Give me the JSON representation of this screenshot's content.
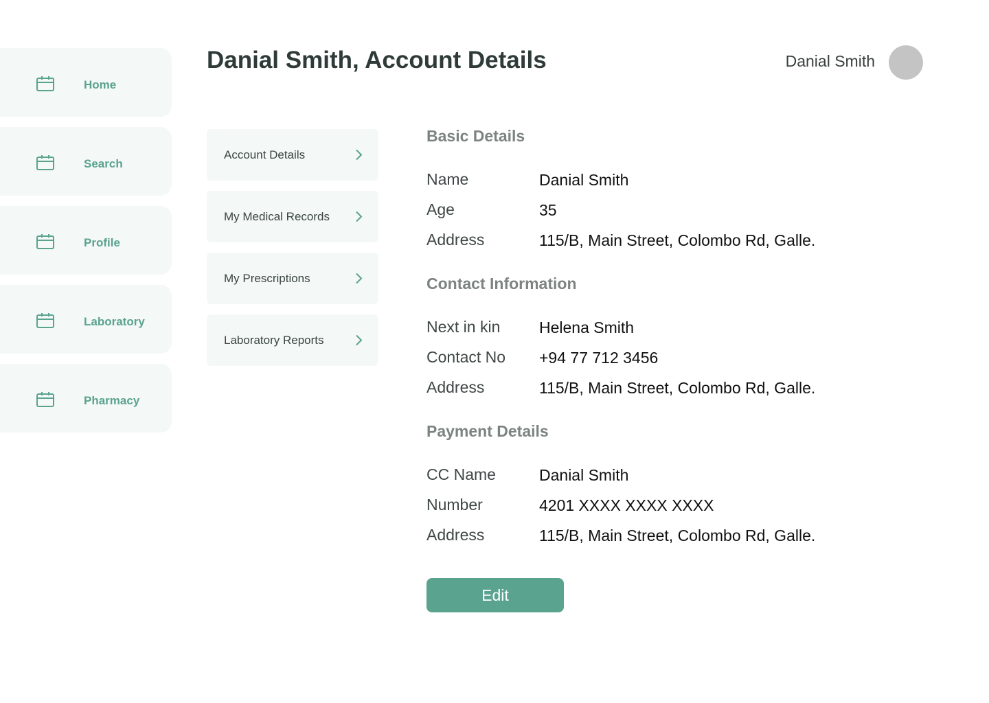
{
  "colors": {
    "accent": "#5aa38e",
    "nav_bg": "#f4f8f7",
    "avatar": "#c4c4c4",
    "title": "#2f3b38",
    "section_title": "#7c8482"
  },
  "sidebar": {
    "items": [
      {
        "label": "Home",
        "icon": "calendar-icon"
      },
      {
        "label": "Search",
        "icon": "calendar-icon"
      },
      {
        "label": "Profile",
        "icon": "calendar-icon"
      },
      {
        "label": "Laboratory",
        "icon": "calendar-icon"
      },
      {
        "label": "Pharmacy",
        "icon": "calendar-icon"
      }
    ]
  },
  "header": {
    "title_prefix": "Danial Smith,",
    "title_bold": "Account Details",
    "user_name": "Danial Smith"
  },
  "submenu": {
    "items": [
      {
        "label": "Account Details",
        "icon": "chevron-right-icon"
      },
      {
        "label": "My Medical Records",
        "icon": "chevron-right-icon"
      },
      {
        "label": "My Prescriptions",
        "icon": "chevron-right-icon"
      },
      {
        "label": "Laboratory Reports",
        "icon": "chevron-right-icon"
      }
    ]
  },
  "details": {
    "basic": {
      "title": "Basic Details",
      "rows": [
        {
          "label": "Name",
          "value": "Danial Smith"
        },
        {
          "label": "Age",
          "value": "35"
        },
        {
          "label": "Address",
          "value": "115/B, Main Street, Colombo Rd, Galle."
        }
      ]
    },
    "contact": {
      "title": "Contact Information",
      "rows": [
        {
          "label": "Next in kin",
          "value": "Helena Smith"
        },
        {
          "label": "Contact No",
          "value": "+94 77 712 3456"
        },
        {
          "label": "Address",
          "value": "115/B, Main Street, Colombo Rd, Galle."
        }
      ]
    },
    "payment": {
      "title": "Payment Details",
      "rows": [
        {
          "label": "CC Name",
          "value": "Danial Smith"
        },
        {
          "label": "Number",
          "value": "4201 XXXX XXXX XXXX"
        },
        {
          "label": "Address",
          "value": "115/B, Main Street, Colombo Rd, Galle."
        }
      ]
    }
  },
  "actions": {
    "edit_label": "Edit"
  }
}
